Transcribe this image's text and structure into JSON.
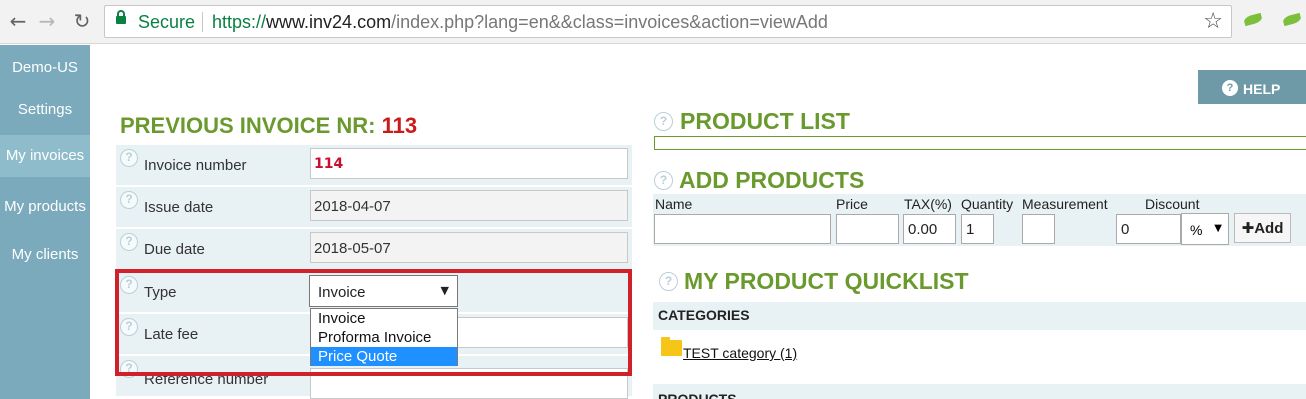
{
  "browser": {
    "secure_label": "Secure",
    "url_scheme": "https://",
    "url_host": "www.inv24.com",
    "url_path": "/index.php?lang=en&&class=invoices&action=viewAdd"
  },
  "sidebar": {
    "items": [
      {
        "label": "Demo-US"
      },
      {
        "label": "Settings"
      },
      {
        "label": "My invoices"
      },
      {
        "label": "My products"
      },
      {
        "label": "My clients"
      }
    ]
  },
  "invoice": {
    "prev_title": "PREVIOUS INVOICE NR:",
    "prev_number": "113",
    "fields": {
      "invoice_number": {
        "label": "Invoice number",
        "value": "114"
      },
      "issue_date": {
        "label": "Issue date",
        "value": "2018-04-07"
      },
      "due_date": {
        "label": "Due date",
        "value": "2018-05-07"
      },
      "type": {
        "label": "Type",
        "value": "Invoice"
      },
      "late_fee": {
        "label": "Late fee",
        "value": ""
      },
      "reference_number": {
        "label": "Reference number",
        "value": ""
      }
    },
    "type_options": [
      "Invoice",
      "Proforma Invoice",
      "Price Quote"
    ],
    "type_highlighted": "Price Quote"
  },
  "help": {
    "label": "HELP"
  },
  "product_list": {
    "title": "PRODUCT LIST"
  },
  "add_products": {
    "title": "ADD PRODUCTS",
    "columns": {
      "name": "Name",
      "price": "Price",
      "tax": "TAX(%)",
      "quantity": "Quantity",
      "measurement": "Measurement",
      "discount": "Discount"
    },
    "values": {
      "name": "",
      "price": "",
      "tax": "0.00",
      "quantity": "1",
      "measurement": "",
      "discount": "0",
      "discount_unit": "%"
    },
    "add_label": "Add"
  },
  "quicklist": {
    "title": "MY PRODUCT QUICKLIST",
    "categories_header": "CATEGORIES",
    "category_link": "TEST category (1)",
    "products_header": "PRODUCTS"
  },
  "colors": {
    "accent_green": "#6a9a2e",
    "invoice_red": "#cc1a1a",
    "sidebar": "#7aaabb",
    "highlight_frame": "#d0212a",
    "option_highlight": "#1e90ff"
  }
}
